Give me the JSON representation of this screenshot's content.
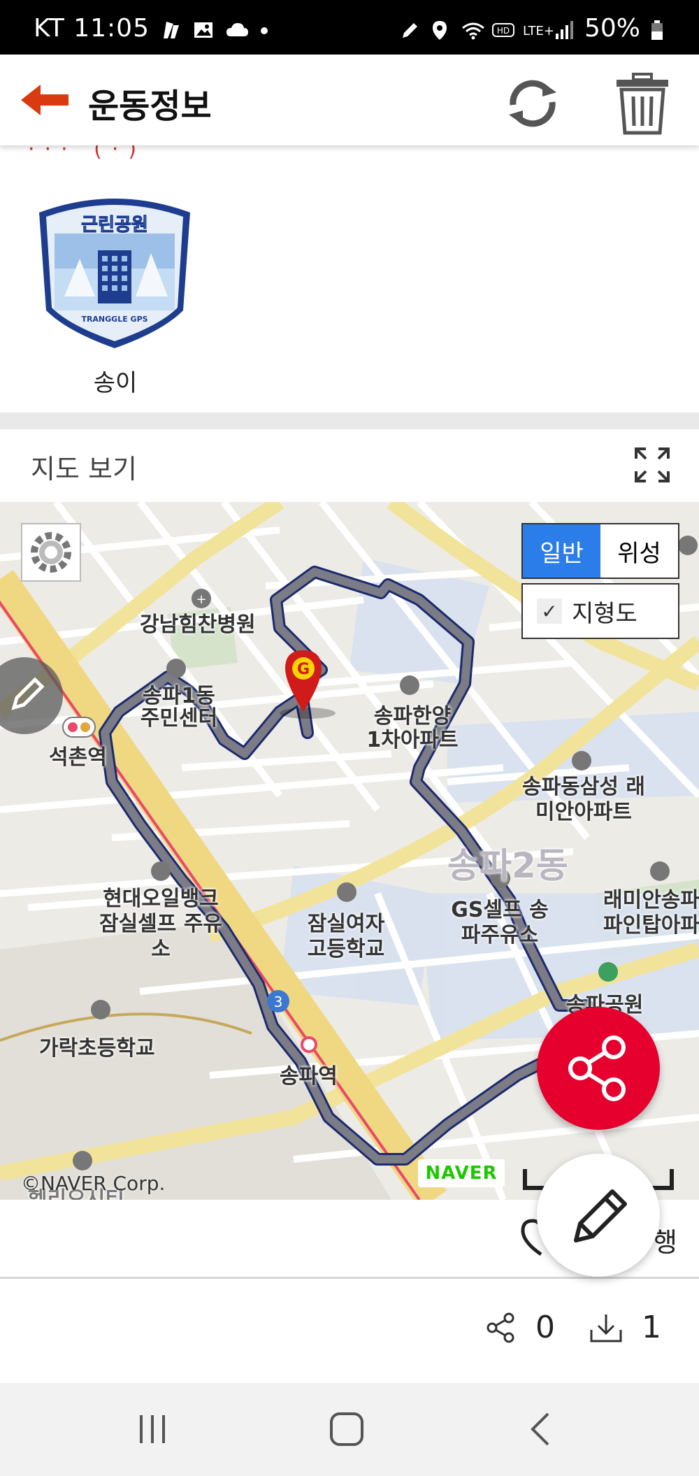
{
  "status_bar": {
    "carrier_time": "KT 11:05",
    "battery": "50%"
  },
  "app_bar": {
    "title": "운동정보"
  },
  "badge": {
    "badge_title": "근린공원",
    "badge_brand": "TRANGGLE GPS",
    "label": "송이"
  },
  "map_section": {
    "header": "지도 보기",
    "map_type_normal": "일반",
    "map_type_satellite": "위성",
    "terrain_label": "지형도",
    "terrain_checked": true,
    "copyright": "©NAVER Corp.",
    "naver_logo": "NAVER",
    "marker_letter": "G",
    "places": [
      "강남힘찬병원",
      "송파1동 주민센터",
      "석촌역",
      "송파한양 1차아파트",
      "송파동삼성 래미안아파트",
      "송파2동",
      "현대오일뱅크 잠실셀프 주유소",
      "잠실여자 고등학교",
      "GS셀프 송파주유소",
      "래미안송파 파인탑아파",
      "송파공원",
      "가락초등학교",
      "송파역",
      "헬리오시티"
    ]
  },
  "actions": {
    "tail_text": "행",
    "share_count": "0",
    "download_count": "1"
  },
  "colors": {
    "accent_red": "#e5002e",
    "back_arrow": "#d93a10",
    "map_toggle_active": "#2b7de9",
    "route": "#7c7c86"
  }
}
